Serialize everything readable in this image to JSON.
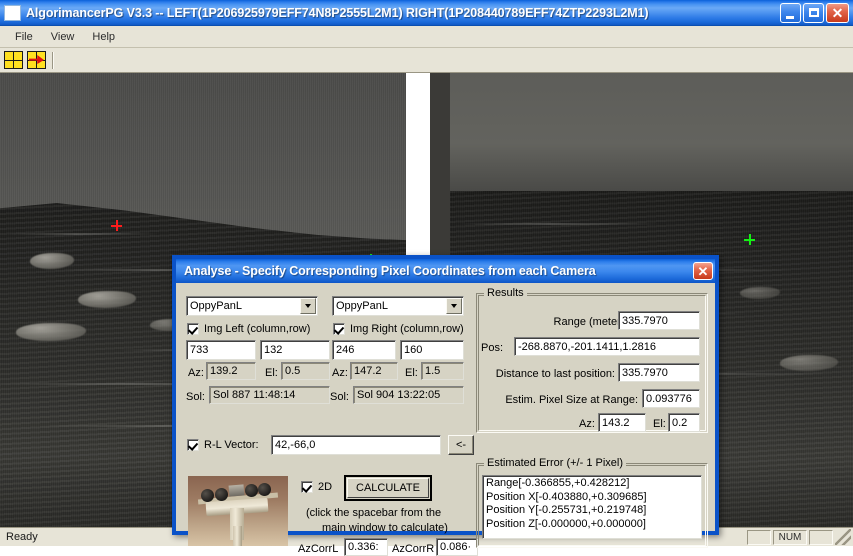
{
  "window": {
    "title": "AlgorimancerPG V3.3 -- LEFT(1P206925979EFF74N8P2555L2M1)  RIGHT(1P208440789EFF74ZTP2293L2M1)",
    "icon": "app-icon",
    "minimize_label": "_",
    "maximize_label": "❐",
    "close_label": "✕"
  },
  "menu": {
    "items": [
      {
        "label": "File"
      },
      {
        "label": "View"
      },
      {
        "label": "Help"
      }
    ]
  },
  "toolbar": {
    "buttons": [
      {
        "name": "grid-icon",
        "tooltip": "Left Image Grid"
      },
      {
        "name": "grid-arrow-icon",
        "tooltip": "Right Image Grid"
      }
    ]
  },
  "image_view": {
    "left_marker": {
      "color": "#ff1c1c",
      "name": "left-image-marker"
    },
    "left_marker_2": {
      "color": "#14f014",
      "name": "left-image-marker-green"
    },
    "right_marker": {
      "color": "#14f014",
      "name": "right-image-marker"
    }
  },
  "status_bar": {
    "message": "Ready",
    "indicators": [
      "",
      "NUM",
      ""
    ]
  },
  "dialog": {
    "title": "Analyse - Specify Corresponding Pixel Coordinates from each Camera",
    "close_label": "✕",
    "left_camera": {
      "selected": "OppyPanL",
      "checkbox_label": "Img Left (column,row)",
      "checked": true,
      "column": "733",
      "row": "132",
      "az_label": "Az:",
      "az_value": "139.2",
      "el_label": "El:",
      "el_value": "0.5",
      "sol_label": "Sol:",
      "sol_value": "Sol 887 11:48:14"
    },
    "right_camera": {
      "selected": "OppyPanL",
      "checkbox_label": "Img Right (column,row)",
      "checked": true,
      "column": "246",
      "row": "160",
      "az_label": "Az:",
      "az_value": "147.2",
      "el_label": "El:",
      "el_value": "1.5",
      "sol_label": "Sol:",
      "sol_value": "Sol 904 13:22:05"
    },
    "rl_vector": {
      "label": "R-L Vector:",
      "checked": true,
      "value": "42,-66,0",
      "apply_button": "<-"
    },
    "results": {
      "group_title": "Results",
      "range_label": "Range (meters):",
      "range_value": "335.7970",
      "pos_label": "Pos:",
      "pos_value": "-268.8870,-201.1411,1.2816",
      "distance_label": "Distance to last position:",
      "distance_value": "335.7970",
      "pixel_size_label": "Estim. Pixel Size at Range:",
      "pixel_size_value": "0.093776",
      "az_label": "Az:",
      "az_value": "143.2",
      "el_label": "El:",
      "el_value": "0.2"
    },
    "estimated_error": {
      "group_title": "Estimated Error (+/- 1 Pixel)",
      "lines": [
        "Range[-0.366855,+0.428212]",
        "Position X[-0.403880,+0.309685]",
        "Position Y[-0.255731,+0.219748]",
        "Position Z[-0.000000,+0.000000]"
      ]
    },
    "controls": {
      "twod_label": "2D",
      "twod_checked": true,
      "calculate_label": "CALCULATE",
      "hint_line1": "(click the spacebar from the",
      "hint_line2": "main window to calculate)",
      "azcorrl_label": "AzCorrL",
      "azcorrl_value": "0.336:",
      "azcorrr_label": "AzCorrR",
      "azcorrr_value": "0.086·"
    },
    "thumbnail": {
      "name": "rover-camera-thumbnail"
    }
  }
}
